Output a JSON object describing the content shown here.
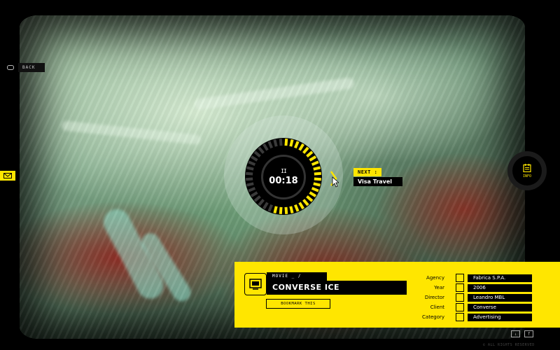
{
  "nav": {
    "back_label": "BACK"
  },
  "player": {
    "pause_symbol": "II",
    "time": "00:18",
    "progress_fraction": 0.55,
    "next_label": "NEXT :",
    "next_title": "Visa Travel"
  },
  "info": {
    "label": "INFO"
  },
  "panel": {
    "movie_head": "MOVIE _ /",
    "movie_title": "CONVERSE ICE",
    "bookmark_label": "BOOKMARK THIS",
    "meta": [
      {
        "label": "Agency",
        "value": "Fabrica S.P.A."
      },
      {
        "label": "Year",
        "value": "2006"
      },
      {
        "label": "Director",
        "value": "Leandro MBL"
      },
      {
        "label": "Client",
        "value": "Converse"
      },
      {
        "label": "Category",
        "value": "Advertising"
      }
    ]
  },
  "footer": {
    "copyright": "© ALL RIGHTS RESERVED"
  },
  "colors": {
    "accent": "#ffe600",
    "background": "#000000"
  },
  "icons": [
    "back-icon",
    "mail-icon",
    "pause-icon",
    "next-chevron-icon",
    "cursor-icon",
    "info-icon",
    "movie-screen-icon",
    "share-icon",
    "facebook-icon"
  ]
}
